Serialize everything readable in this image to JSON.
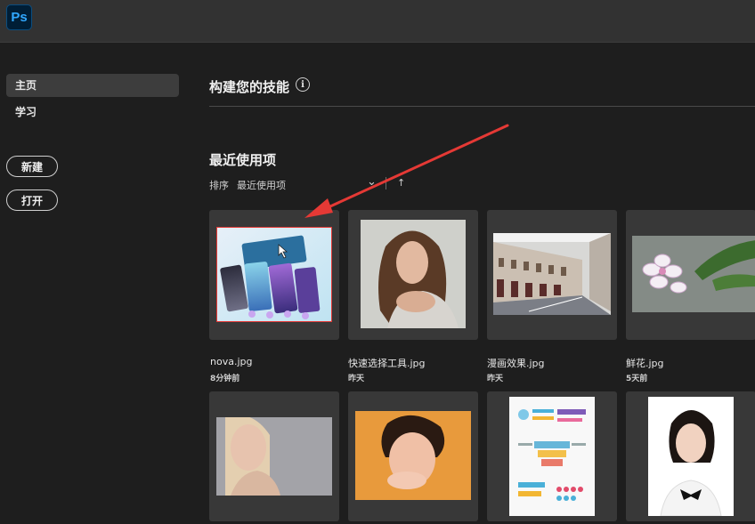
{
  "app": {
    "logo_text": "Ps"
  },
  "sidebar": {
    "items": [
      {
        "label": "主页",
        "active": true
      },
      {
        "label": "学习",
        "active": false
      }
    ],
    "new_button": "新建",
    "open_button": "打开"
  },
  "main": {
    "skills_title": "构建您的技能",
    "info_glyph": "i",
    "recent_title": "最近使用项",
    "sort": {
      "label": "排序",
      "value": "最近使用项",
      "dropdown_icon": "⌄",
      "direction_icon": "↑"
    }
  },
  "files": [
    {
      "name": "nova.jpg",
      "time": "8分钟前"
    },
    {
      "name": "快速选择工具.jpg",
      "time": "昨天"
    },
    {
      "name": "漫画效果.jpg",
      "time": "昨天"
    },
    {
      "name": "鲜花.jpg",
      "time": "5天前"
    },
    {
      "name": "",
      "time": ""
    },
    {
      "name": "",
      "time": ""
    },
    {
      "name": "",
      "time": ""
    },
    {
      "name": "",
      "time": ""
    }
  ],
  "annotation": {
    "color": "#e53935"
  }
}
